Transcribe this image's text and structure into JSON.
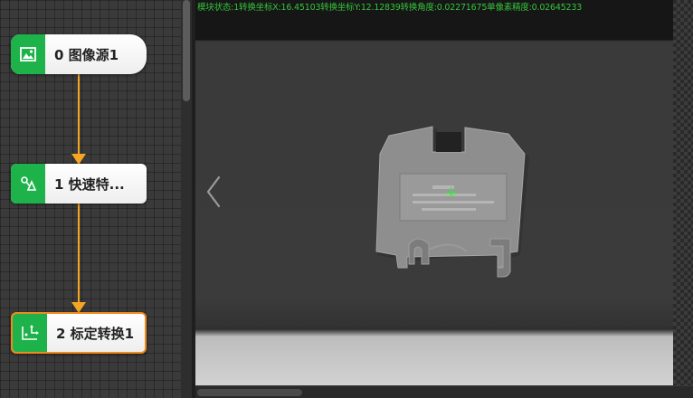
{
  "flow": {
    "nodes": [
      {
        "index": 0,
        "label": "0 图像源1",
        "icon": "image-icon"
      },
      {
        "index": 1,
        "label": "1 快速特...",
        "icon": "feature-match-icon"
      },
      {
        "index": 2,
        "label": "2 标定转换1",
        "icon": "calibration-transform-icon",
        "selected": true
      }
    ]
  },
  "viewer": {
    "status_text": "模块状态:1转换坐标X:16.45103转换坐标Y:12.12839转换角度:0.02271675单像素精度:0.02645233",
    "prev_icon": "chevron-left-icon"
  },
  "colors": {
    "node_icon_bg": "#1db34a",
    "connector": "#f5a623",
    "selected_border": "#f08a1c",
    "status_text": "#35c43b",
    "crosshair": "#39e63a"
  }
}
